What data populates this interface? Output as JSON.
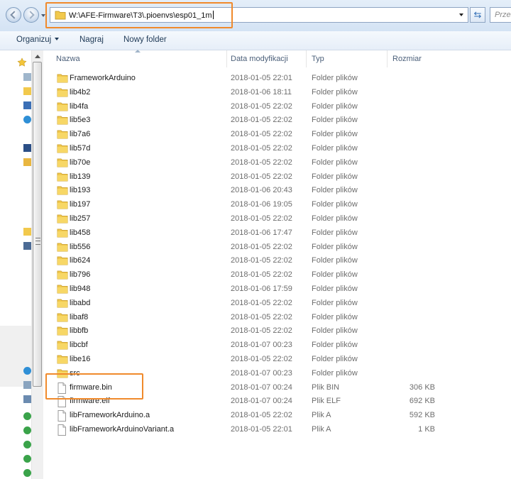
{
  "address_bar": {
    "path": "W:\\AFE-Firmware\\T3\\.pioenvs\\esp01_1m"
  },
  "search": {
    "placeholder": "Przes"
  },
  "toolbar": {
    "organize_label": "Organizuj",
    "burn_label": "Nagraj",
    "new_folder_label": "Nowy folder"
  },
  "columns": {
    "name": "Nazwa",
    "date": "Data modyfikacji",
    "type": "Typ",
    "size": "Rozmiar"
  },
  "files": [
    {
      "name": "FrameworkArduino",
      "date": "2018-01-05 22:01",
      "type": "Folder plików",
      "size": "",
      "kind": "folder"
    },
    {
      "name": "lib4b2",
      "date": "2018-01-06 18:11",
      "type": "Folder plików",
      "size": "",
      "kind": "folder"
    },
    {
      "name": "lib4fa",
      "date": "2018-01-05 22:02",
      "type": "Folder plików",
      "size": "",
      "kind": "folder"
    },
    {
      "name": "lib5e3",
      "date": "2018-01-05 22:02",
      "type": "Folder plików",
      "size": "",
      "kind": "folder"
    },
    {
      "name": "lib7a6",
      "date": "2018-01-05 22:02",
      "type": "Folder plików",
      "size": "",
      "kind": "folder"
    },
    {
      "name": "lib57d",
      "date": "2018-01-05 22:02",
      "type": "Folder plików",
      "size": "",
      "kind": "folder"
    },
    {
      "name": "lib70e",
      "date": "2018-01-05 22:02",
      "type": "Folder plików",
      "size": "",
      "kind": "folder"
    },
    {
      "name": "lib139",
      "date": "2018-01-05 22:02",
      "type": "Folder plików",
      "size": "",
      "kind": "folder"
    },
    {
      "name": "lib193",
      "date": "2018-01-06 20:43",
      "type": "Folder plików",
      "size": "",
      "kind": "folder"
    },
    {
      "name": "lib197",
      "date": "2018-01-06 19:05",
      "type": "Folder plików",
      "size": "",
      "kind": "folder"
    },
    {
      "name": "lib257",
      "date": "2018-01-05 22:02",
      "type": "Folder plików",
      "size": "",
      "kind": "folder"
    },
    {
      "name": "lib458",
      "date": "2018-01-06 17:47",
      "type": "Folder plików",
      "size": "",
      "kind": "folder"
    },
    {
      "name": "lib556",
      "date": "2018-01-05 22:02",
      "type": "Folder plików",
      "size": "",
      "kind": "folder"
    },
    {
      "name": "lib624",
      "date": "2018-01-05 22:02",
      "type": "Folder plików",
      "size": "",
      "kind": "folder"
    },
    {
      "name": "lib796",
      "date": "2018-01-05 22:02",
      "type": "Folder plików",
      "size": "",
      "kind": "folder"
    },
    {
      "name": "lib948",
      "date": "2018-01-06 17:59",
      "type": "Folder plików",
      "size": "",
      "kind": "folder"
    },
    {
      "name": "libabd",
      "date": "2018-01-05 22:02",
      "type": "Folder plików",
      "size": "",
      "kind": "folder"
    },
    {
      "name": "libaf8",
      "date": "2018-01-05 22:02",
      "type": "Folder plików",
      "size": "",
      "kind": "folder"
    },
    {
      "name": "libbfb",
      "date": "2018-01-05 22:02",
      "type": "Folder plików",
      "size": "",
      "kind": "folder"
    },
    {
      "name": "libcbf",
      "date": "2018-01-07 00:23",
      "type": "Folder plików",
      "size": "",
      "kind": "folder"
    },
    {
      "name": "libe16",
      "date": "2018-01-05 22:02",
      "type": "Folder plików",
      "size": "",
      "kind": "folder"
    },
    {
      "name": "src",
      "date": "2018-01-07 00:23",
      "type": "Folder plików",
      "size": "",
      "kind": "folder"
    },
    {
      "name": "firmware.bin",
      "date": "2018-01-07 00:24",
      "type": "Plik BIN",
      "size": "306 KB",
      "kind": "file"
    },
    {
      "name": "firmware.elf",
      "date": "2018-01-07 00:24",
      "type": "Plik ELF",
      "size": "692 KB",
      "kind": "file"
    },
    {
      "name": "libFrameworkArduino.a",
      "date": "2018-01-05 22:02",
      "type": "Plik A",
      "size": "592 KB",
      "kind": "file"
    },
    {
      "name": "libFrameworkArduinoVariant.a",
      "date": "2018-01-05 22:01",
      "type": "Plik A",
      "size": "1 KB",
      "kind": "file"
    }
  ],
  "colors": {
    "folder_yellow": "#f2c94c",
    "highlight_orange": "#f08a2c",
    "toolbar_text": "#1e3956"
  }
}
